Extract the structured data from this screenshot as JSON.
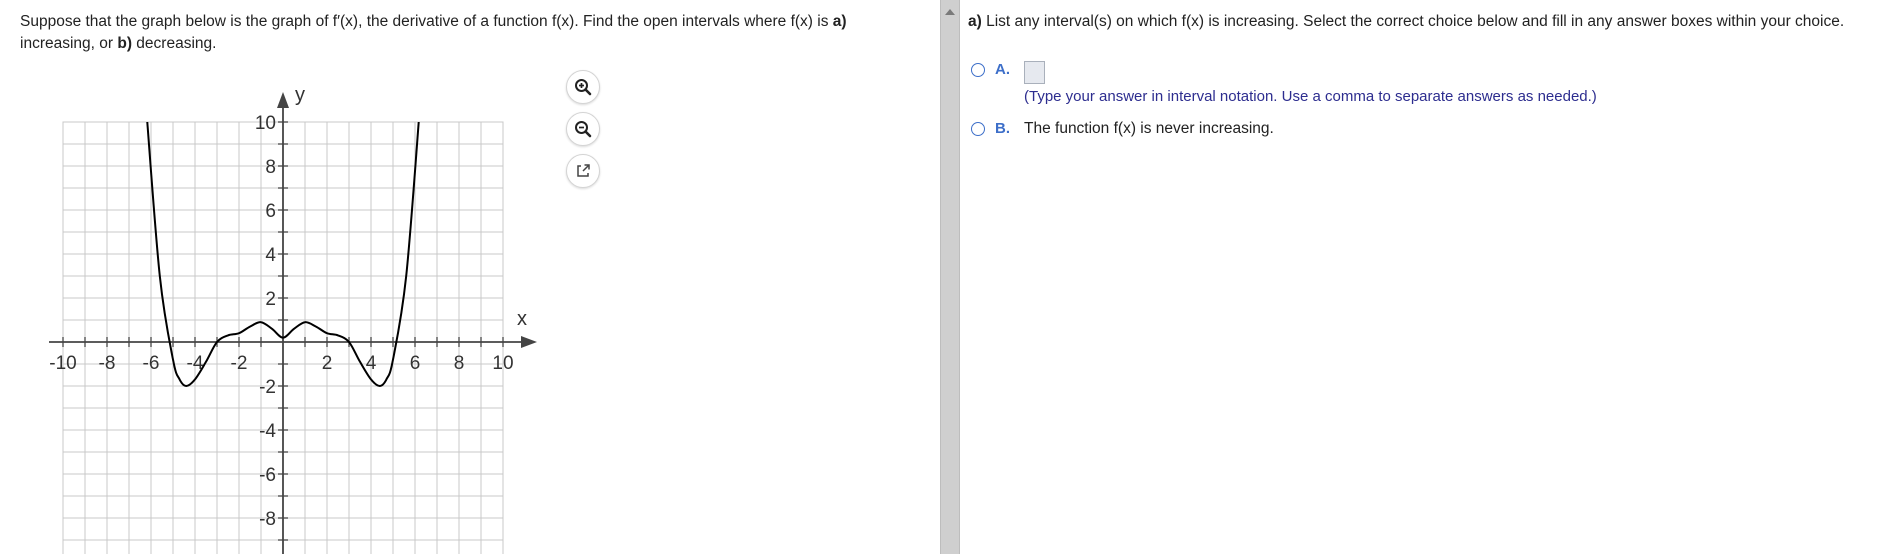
{
  "question": {
    "text_1": "Suppose that the graph below is the graph of f′(x), the derivative of a function f(x). Find the open intervals where f(x) is ",
    "bold_a": "a)",
    "text_2": " increasing, or ",
    "bold_b": "b)",
    "text_3": " decreasing."
  },
  "toolbar": {
    "zoom_in_icon": "zoom-in-icon",
    "zoom_out_icon": "zoom-out-icon",
    "popout_icon": "popout-icon"
  },
  "chart_data": {
    "type": "line",
    "function": "f'(x)",
    "xlabel": "x",
    "ylabel": "y",
    "xlim": [
      -10,
      10
    ],
    "ylim": [
      -10,
      10
    ],
    "grid": true,
    "x_ticks": [
      "-10",
      "-8",
      "-6",
      "-4",
      "-2",
      "2",
      "4",
      "6",
      "8",
      "10"
    ],
    "y_ticks": [
      "10",
      "8",
      "6",
      "4",
      "2",
      "-2",
      "-4",
      "-6",
      "-8",
      "-10"
    ],
    "series": [
      {
        "color": "#000000",
        "x": [
          -6.2,
          -5.6,
          -5,
          -4.7,
          -4.4,
          -4,
          -3.5,
          -3,
          -2.5,
          -2,
          -1.5,
          -1,
          -0.5,
          0,
          0.5,
          1,
          1.5,
          2,
          2.5,
          3,
          3.5,
          4,
          4.4,
          4.7,
          5,
          5.6,
          6.2
        ],
        "y": [
          10.4,
          3.0,
          -0.8,
          -1.7,
          -2.0,
          -1.7,
          -0.9,
          0,
          0.3,
          0.4,
          0.7,
          0.9,
          0.6,
          0.2,
          0.6,
          0.9,
          0.7,
          0.4,
          0.3,
          0,
          -0.9,
          -1.7,
          -2.0,
          -1.7,
          -0.8,
          3.0,
          10.4
        ]
      }
    ]
  },
  "part_a": {
    "label": "a)",
    "prompt": " List any interval(s) on which f(x) is increasing. Select the correct choice below and fill in any answer boxes within your choice.",
    "choice_a_letter": "A.",
    "choice_a_value": "",
    "choice_a_hint": "(Type your answer in interval notation. Use a comma to separate answers as needed.)",
    "choice_b_letter": "B.",
    "choice_b_text": "The function f(x) is never increasing."
  },
  "colors": {
    "accent": "#3d6fc9",
    "hint": "#2d2d8f",
    "grid": "#c8c8c8",
    "axis": "#444444",
    "divider": "#cfcfcf"
  }
}
